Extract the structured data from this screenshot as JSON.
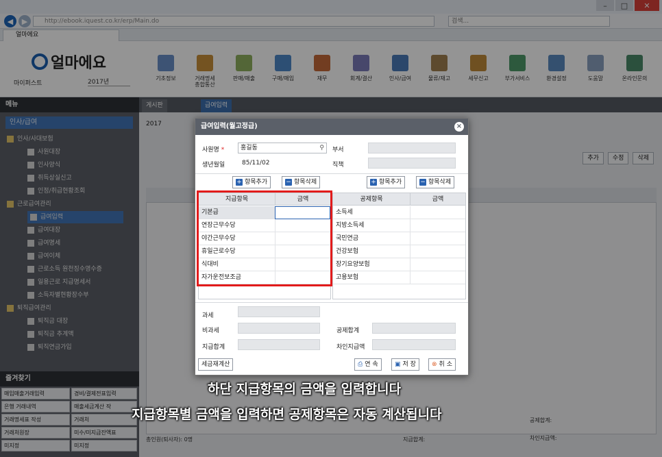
{
  "browser": {
    "url": "http://ebook.iquest.co.kr/erp/Main.do",
    "search_placeholder": "검색...",
    "tab_title": "얼마에요",
    "win_minimize": "–",
    "win_maximize": "□",
    "win_close": "✕"
  },
  "app": {
    "logo_text": "얼마에요",
    "mypage": "마이퍼스트",
    "year": "2017년",
    "menu": [
      "기초정보",
      "거래명세\n총합통산",
      "판매/매출",
      "구매/매입",
      "재무",
      "회계/결산",
      "인사/급여",
      "물류/재고",
      "세무신고",
      "부가서비스",
      "환경설정",
      "도움말",
      "온라인문의"
    ]
  },
  "sidebar": {
    "header": "메뉴",
    "selected": "인사/급여",
    "items": [
      {
        "label": "인사/사대보험",
        "level": 0
      },
      {
        "label": "사원대장",
        "level": 1
      },
      {
        "label": "인사양식",
        "level": 1
      },
      {
        "label": "취득상실신고",
        "level": 1
      },
      {
        "label": "인정/취급현황조회",
        "level": 1
      },
      {
        "label": "근로급여관리",
        "level": 0
      },
      {
        "label": "급여입력",
        "level": 1,
        "active": true
      },
      {
        "label": "급여대장",
        "level": 1
      },
      {
        "label": "급여명세",
        "level": 1
      },
      {
        "label": "급여이체",
        "level": 1
      },
      {
        "label": "근로소득 원천징수영수증",
        "level": 1
      },
      {
        "label": "일용근로 지급명세서",
        "level": 1
      },
      {
        "label": "소득자별현황장수부",
        "level": 1
      },
      {
        "label": "퇴직급여관리",
        "level": 0
      },
      {
        "label": "퇴직금 대장",
        "level": 1
      },
      {
        "label": "퇴직금 추계액",
        "level": 1
      },
      {
        "label": "퇴직연금가입",
        "level": 1
      }
    ],
    "fav_header": "즐겨찾기",
    "favorites": [
      [
        "매입매출거래입력",
        "경비/결제전표입력"
      ],
      [
        "은행 거래내역",
        "매출세금계산 작"
      ],
      [
        "거래명세표 작성",
        "거래처"
      ],
      [
        "거래처원장",
        "미수/미지급잔액표"
      ],
      [
        "미지정",
        "미지정"
      ]
    ]
  },
  "main": {
    "tabs": [
      "게시판",
      "급여입력"
    ],
    "year": "2017",
    "buttons": {
      "add": "추가",
      "edit": "수정",
      "delete": "삭제"
    },
    "bottom": {
      "emp_count_label": "총인원(퇴사자):",
      "emp_count_value": "0명",
      "pay_total_label": "지급합계:",
      "deduct_total_label": "공제합계:",
      "net_label": "차인지급액:"
    }
  },
  "dialog": {
    "title": "급여입력(월고정급)",
    "emp_name_label": "사원명",
    "emp_name_value": "홍길동",
    "dept_label": "부서",
    "birth_label": "생년월일",
    "birth_value": "85/11/02",
    "position_label": "직책",
    "add_item": "항목추가",
    "del_item": "항목삭제",
    "pay_headers": [
      "지급항목",
      "금액"
    ],
    "pay_items": [
      "기본급",
      "연장근무수당",
      "야간근무수당",
      "휴일근로수당",
      "식대비",
      "자가운전보조금"
    ],
    "deduct_headers": [
      "공제항목",
      "금액"
    ],
    "deduct_items": [
      "소득세",
      "지방소득세",
      "국민연금",
      "건강보험",
      "장기요양보험",
      "고용보험"
    ],
    "taxable_label": "과세",
    "nontaxable_label": "비과세",
    "pay_total_label": "지급합계",
    "deduct_total_label": "공제합계",
    "net_label": "차인지급액",
    "recalc_btn": "세금재계산",
    "continue_btn": "연 속",
    "save_btn": "저 장",
    "cancel_btn": "취 소"
  },
  "subtitles": {
    "line1": "하단 지급항목의 금액을 입력합니다",
    "line2": "지급항목별 금액을 입력하면 공제항목은 자동 계산됩니다"
  },
  "colors": {
    "accent": "#1b5fb0",
    "highlight_box": "#e21b1b",
    "dialog_title_bg": "#5b6069"
  }
}
